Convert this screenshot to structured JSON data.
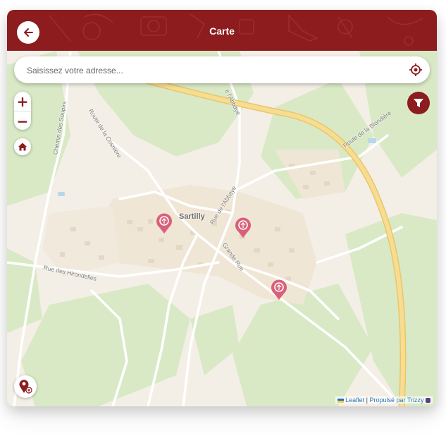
{
  "header": {
    "title": "Carte",
    "background": "#8c1c1e"
  },
  "search": {
    "placeholder": "Saisissez votre adresse..."
  },
  "map": {
    "town_label": "Sartilly",
    "street_labels": {
      "route_cosniere": "Route de la Cosnière",
      "chemin_soupirs": "Chemin des Soupirs",
      "rue_abbaye": "Rue de l'Abbaye",
      "rue_abbaye_top": "e l'Abbaye",
      "route_blondiere": "Route de la Blondière",
      "grande_rue": "Grande Rue",
      "rue_hirondelles": "Rue des Hirondelles"
    },
    "marker_color": "#d9607a",
    "land_color": "#f4efe6",
    "green_color": "#d7e8c2",
    "highway_color": "#f6d98a"
  },
  "attribution": {
    "leaflet": "Leaflet",
    "separator": " | ",
    "powered": "Propulsé par Trizzy"
  }
}
